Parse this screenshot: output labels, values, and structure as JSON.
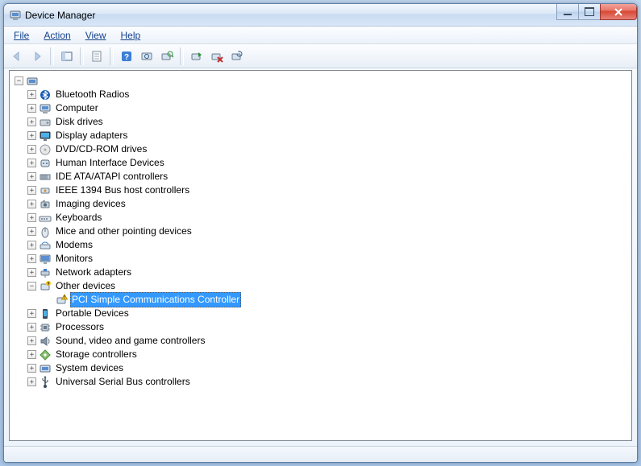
{
  "window": {
    "title": "Device Manager"
  },
  "menu": {
    "file": "File",
    "action": "Action",
    "view": "View",
    "help": "Help"
  },
  "root": {
    "label": ""
  },
  "categories": [
    {
      "label": "Bluetooth Radios",
      "icon": "bluetooth",
      "expanded": false,
      "children": []
    },
    {
      "label": "Computer",
      "icon": "computer",
      "expanded": false,
      "children": []
    },
    {
      "label": "Disk drives",
      "icon": "disk",
      "expanded": false,
      "children": []
    },
    {
      "label": "Display adapters",
      "icon": "display",
      "expanded": false,
      "children": []
    },
    {
      "label": "DVD/CD-ROM drives",
      "icon": "cdrom",
      "expanded": false,
      "children": []
    },
    {
      "label": "Human Interface Devices",
      "icon": "hid",
      "expanded": false,
      "children": []
    },
    {
      "label": "IDE ATA/ATAPI controllers",
      "icon": "ide",
      "expanded": false,
      "children": []
    },
    {
      "label": "IEEE 1394 Bus host controllers",
      "icon": "firewire",
      "expanded": false,
      "children": []
    },
    {
      "label": "Imaging devices",
      "icon": "camera",
      "expanded": false,
      "children": []
    },
    {
      "label": "Keyboards",
      "icon": "keyboard",
      "expanded": false,
      "children": []
    },
    {
      "label": "Mice and other pointing devices",
      "icon": "mouse",
      "expanded": false,
      "children": []
    },
    {
      "label": "Modems",
      "icon": "modem",
      "expanded": false,
      "children": []
    },
    {
      "label": "Monitors",
      "icon": "monitor",
      "expanded": false,
      "children": []
    },
    {
      "label": "Network adapters",
      "icon": "network",
      "expanded": false,
      "children": []
    },
    {
      "label": "Other devices",
      "icon": "other",
      "expanded": true,
      "children": [
        {
          "label": "PCI Simple Communications Controller",
          "icon": "warning",
          "selected": true
        }
      ]
    },
    {
      "label": "Portable Devices",
      "icon": "portable",
      "expanded": false,
      "children": []
    },
    {
      "label": "Processors",
      "icon": "cpu",
      "expanded": false,
      "children": []
    },
    {
      "label": "Sound, video and game controllers",
      "icon": "sound",
      "expanded": false,
      "children": []
    },
    {
      "label": "Storage controllers",
      "icon": "storage",
      "expanded": false,
      "children": []
    },
    {
      "label": "System devices",
      "icon": "system",
      "expanded": false,
      "children": []
    },
    {
      "label": "Universal Serial Bus controllers",
      "icon": "usb",
      "expanded": false,
      "children": []
    }
  ]
}
